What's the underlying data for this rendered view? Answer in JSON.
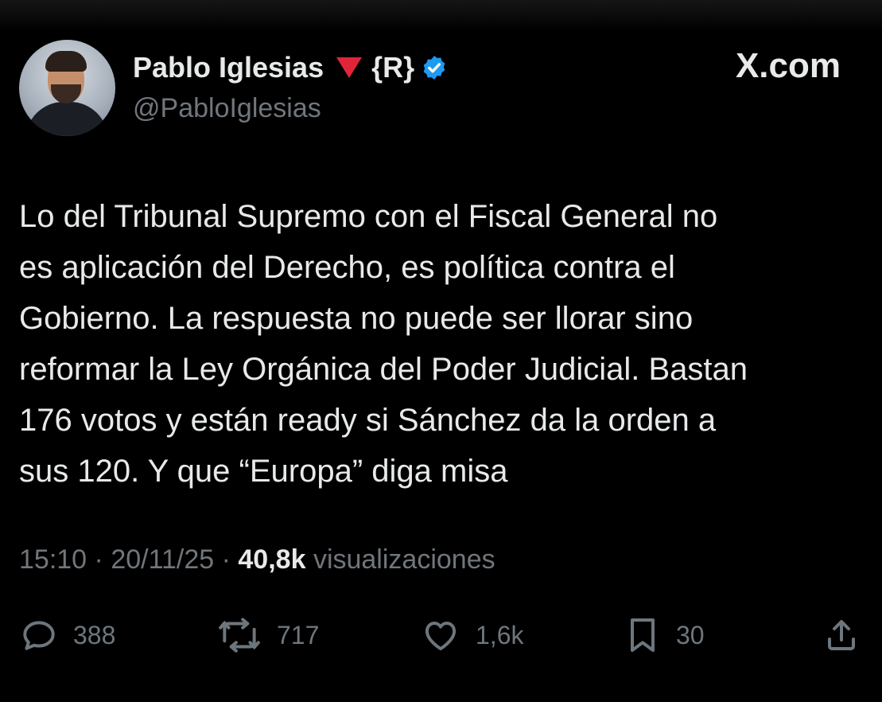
{
  "tweet": {
    "author": {
      "display_name": "Pablo Iglesias",
      "tag": "{R}",
      "handle": "@PabloIglesias",
      "avatar_icon": "profile-photo",
      "flag_icon": "red-triangle-down",
      "verified_icon": "verified-badge",
      "verified_color": "#1d9bf0"
    },
    "brand": "X.com",
    "text": "Lo del Tribunal Supremo con el Fiscal General no\nes aplicación del Derecho, es política contra el\nGobierno. La respuesta no puede ser llorar sino\nreformar la Ley Orgánica del Poder Judicial. Bastan\n176 votos y están ready si Sánchez da la orden a\nsus 120. Y que “Europa” diga misa",
    "time": "15:10",
    "date": "20/11/25",
    "separator": "·",
    "views_count": "40,8k",
    "views_label": "visualizaciones",
    "actions": {
      "replies": "388",
      "reposts": "717",
      "likes": "1,6k",
      "bookmarks": "30"
    }
  },
  "colors": {
    "background": "#000000",
    "text": "#e7e9ea",
    "secondary": "#71767b",
    "flag": "#e0253a",
    "verified": "#1d9bf0"
  }
}
